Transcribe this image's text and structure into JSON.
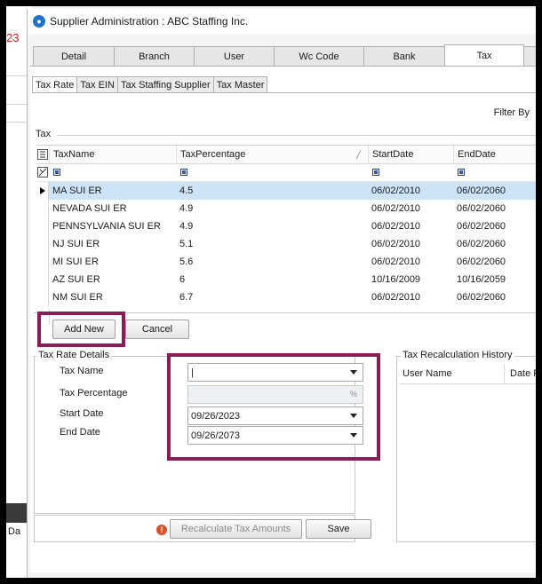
{
  "background": {
    "red_text": "23",
    "side_text": "Da"
  },
  "window": {
    "title": "Supplier Administration : ABC Staffing Inc."
  },
  "top_tabs": [
    "Detail",
    "Branch",
    "User",
    "Wc Code",
    "Bank",
    "Tax"
  ],
  "sub_tabs": [
    "Tax Rate",
    "Tax EIN",
    "Tax Staffing Supplier",
    "Tax Master"
  ],
  "filter_label": "Filter By",
  "tax_group_label": "Tax",
  "grid": {
    "columns": [
      "TaxName",
      "TaxPercentage",
      "StartDate",
      "EndDate"
    ],
    "rows": [
      [
        "MA SUI ER",
        "4.5",
        "06/02/2010",
        "06/02/2060"
      ],
      [
        "NEVADA SUI ER",
        "4.9",
        "06/02/2010",
        "06/02/2060"
      ],
      [
        "PENNSYLVANIA SUI ER",
        "4.9",
        "06/02/2010",
        "06/02/2060"
      ],
      [
        "NJ SUI ER",
        "5.1",
        "06/02/2010",
        "06/02/2060"
      ],
      [
        "MI SUI ER",
        "5.6",
        "06/02/2010",
        "06/02/2060"
      ],
      [
        "AZ SUI ER",
        "6",
        "10/16/2009",
        "10/16/2059"
      ],
      [
        "NM SUI ER",
        "6.7",
        "06/02/2010",
        "06/02/2060"
      ]
    ]
  },
  "buttons": {
    "add_new": "Add New",
    "cancel": "Cancel",
    "recalculate": "Recalculate Tax Amounts",
    "save": "Save"
  },
  "details": {
    "title": "Tax Rate Details",
    "tax_name_label": "Tax Name",
    "tax_name_value": "|",
    "tax_percentage_label": "Tax Percentage",
    "tax_percentage_suffix": "%",
    "start_date_label": "Start Date",
    "start_date_value": "09/26/2023",
    "end_date_label": "End Date",
    "end_date_value": "09/26/2073"
  },
  "history": {
    "title": "Tax Recalculation History",
    "columns": [
      "User Name",
      "Date Recalc"
    ]
  },
  "colors": {
    "highlight": "#8c1c55",
    "selection": "#cce3f8",
    "warning": "#d9532a"
  }
}
